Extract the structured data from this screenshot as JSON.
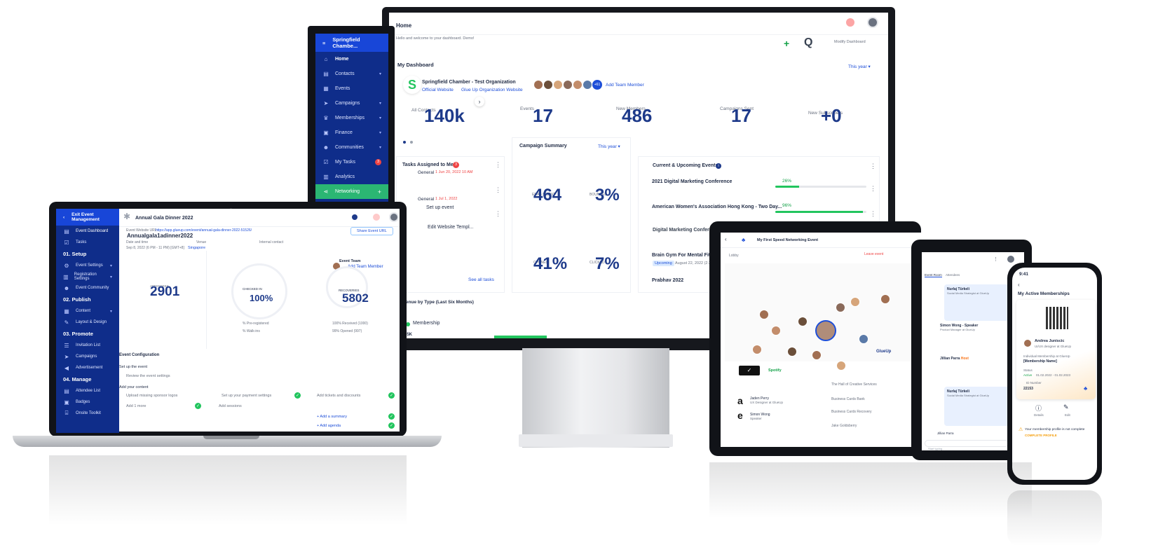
{
  "monitor": {
    "header_title": "Home",
    "header_sub": "Hello and welcome to your dashboard. Demo!",
    "modify_label": "Modify Dashboard",
    "org_short": "Springfield Chambe...",
    "nav": [
      {
        "label": "Home",
        "icon": "home-icon"
      },
      {
        "label": "Contacts",
        "icon": "contacts-icon"
      },
      {
        "label": "Events",
        "icon": "calendar-icon"
      },
      {
        "label": "Campaigns",
        "icon": "send-icon"
      },
      {
        "label": "Memberships",
        "icon": "crown-icon"
      },
      {
        "label": "Finance",
        "icon": "wallet-icon"
      },
      {
        "label": "Communities",
        "icon": "people-icon"
      },
      {
        "label": "My Tasks",
        "icon": "tasks-icon",
        "badge": "3"
      },
      {
        "label": "Analytics",
        "icon": "chart-icon"
      },
      {
        "label": "Networking",
        "icon": "share-icon"
      }
    ],
    "dashboard_title": "My Dashboard",
    "this_year": "This year",
    "org_name": "Springfield Chamber - Test Organization",
    "official_website": "Official Website",
    "glue_up_site": "Glue Up Organization Website",
    "team_more": "+61",
    "add_team_member": "Add Team Member",
    "stats": [
      {
        "value": "140k",
        "label": "All Contacts"
      },
      {
        "value": "17",
        "label": "Events"
      },
      {
        "value": "486",
        "label": "New Members"
      },
      {
        "value": "17",
        "label": "Campaigns Sent"
      },
      {
        "value": "+0",
        "label": "New Subscribers"
      }
    ],
    "tasks_title": "Tasks Assigned to Me",
    "tasks_badge": "3",
    "tasks": [
      {
        "cat": "General",
        "date": "1 Jun 20, 2022 10 AM",
        "name": "Set up event"
      },
      {
        "cat": "General",
        "date": "1 Jul 1, 2022",
        "name": "Edit Website Templ..."
      }
    ],
    "see_all_tasks": "See all tasks",
    "campaign_title": "Campaign Summary",
    "campaign_this_year": "This year",
    "campaign_stats": [
      {
        "value": "464",
        "label": "EMAILS SENT"
      },
      {
        "value": "3%",
        "label": "BOUNCED"
      },
      {
        "value": "41%",
        "label": "OPENED"
      },
      {
        "value": "7%",
        "label": "CLICKED"
      }
    ],
    "events_title": "Current & Upcoming Events",
    "events": [
      {
        "name": "2021 Digital Marketing Conference",
        "pct": "26%",
        "progress": 0.26
      },
      {
        "name": "American Women's Association Hong Kong - Two Day...",
        "pct": "96%",
        "progress": 0.96
      },
      {
        "name": "Digital Marketing Conference Melbourne",
        "pct": "",
        "progress": 0
      },
      {
        "name": "Brain Gym For Mental Fitness",
        "pct": "",
        "progress": 0
      },
      {
        "name": "Prabhav 2022",
        "pct": "",
        "progress": 0
      }
    ],
    "upcoming_tag": "Upcoming",
    "upcoming_date": "August 22, 2022 (2:30 P...",
    "by_type_title": "Revenue by Type (Last Six Months)",
    "membership_label": "Membership",
    "membership_value": "55K"
  },
  "laptop": {
    "exit_label": "Exit Event Management",
    "event_name": "Annualgala1adinner2022",
    "event_name_top": "Annual Gala Dinner 2022",
    "website_label": "Event Website URL:",
    "website_url": "https://app.glueup.com/event/annual-gala-dinner-2022-51526/",
    "share_btn": "Share Event URL",
    "date_label": "Date and time",
    "date_value": "Sep 8, 2022 (6 PM - 11 PM) [GMT+8]",
    "venue_label": "Venue",
    "venue_value": "Singapore",
    "contact_label": "Internal contact",
    "event_team": "Event Team",
    "add_team_member": "Add Team Member",
    "nav": [
      {
        "label": "Event Dashboard",
        "type": "item",
        "icon": "dashboard-icon"
      },
      {
        "label": "Tasks",
        "type": "item",
        "icon": "tasks-icon"
      },
      {
        "label": "01. Setup",
        "type": "section"
      },
      {
        "label": "Event Settings",
        "type": "item",
        "icon": "settings-icon"
      },
      {
        "label": "Registration Settings",
        "type": "item",
        "icon": "form-icon"
      },
      {
        "label": "Event Community",
        "type": "item",
        "icon": "people-icon"
      },
      {
        "label": "02. Publish",
        "type": "section"
      },
      {
        "label": "Content",
        "type": "item",
        "icon": "content-icon"
      },
      {
        "label": "Layout & Design",
        "type": "item",
        "icon": "design-icon"
      },
      {
        "label": "03. Promote",
        "type": "section"
      },
      {
        "label": "Invitation List",
        "type": "item",
        "icon": "list-icon"
      },
      {
        "label": "Campaigns",
        "type": "item",
        "icon": "send-icon"
      },
      {
        "label": "Advertisement",
        "type": "item",
        "icon": "megaphone-icon"
      },
      {
        "label": "04. Manage",
        "type": "section"
      },
      {
        "label": "Attendee List",
        "type": "item",
        "icon": "attendee-icon"
      },
      {
        "label": "Badges",
        "type": "item",
        "icon": "badge-icon"
      },
      {
        "label": "Onsite Toolkit",
        "type": "item",
        "icon": "toolkit-icon"
      }
    ],
    "stats": [
      {
        "value": "2901",
        "label": "ATTENDEES"
      },
      {
        "value": "100%",
        "label": "CHECKED IN"
      },
      {
        "value": "5802",
        "label": "RECOVERIES"
      }
    ],
    "legend": [
      "% Pre-registered",
      "% Walk-ins",
      "100% Received (1000)",
      "99% Opened (997)"
    ],
    "config_title": "Event Configuration",
    "setup_label": "Set up the event",
    "setup_item": "Review the event settings",
    "content_label": "Add your content",
    "config_items": [
      "Upload missing sponsor logos",
      "Set up your payment settings",
      "Add tickets and discounts",
      "Add 1 more",
      "Add sessions",
      "+ Add a summary",
      "+ Add agenda"
    ]
  },
  "tablet": {
    "title": "My First Speed Networking Event",
    "lobby": "Lobby",
    "leave_btn": "Leave event",
    "list_items": [
      "The Hall of Creative Services",
      "Business Cards Bank",
      "Business Cards Recovery",
      "Jake Goldsberry"
    ],
    "people": [
      {
        "name": "Jaden Perry",
        "role": "UX Designer at GlueUp"
      },
      {
        "name": "Simon Wong",
        "role": "Speaker"
      }
    ],
    "brand": "GlueUp",
    "spotify": "Spotify"
  },
  "chat": {
    "tabs": [
      "Event Room",
      "Attendees"
    ],
    "messages": [
      {
        "name": "Nurlaj Türkeli",
        "role": "Social Media Strategist at GlueUp"
      },
      {
        "name": "Simon Wong - Speaker",
        "role": "Product Manager at GlueUp"
      },
      {
        "name": "Jillian Parra",
        "role": "Host"
      },
      {
        "name": "Nurlaj Türkeli",
        "role": "Social Media Strategist at GlueUp"
      },
      {
        "name": "Jillian Parra",
        "role": ""
      }
    ],
    "input_placeholder": "Start typing..."
  },
  "phone": {
    "time": "9:41",
    "title": "My Active Memberships",
    "member_name": "Andrea Juniscic",
    "member_role": "UI/UX designer at GlueUp",
    "plan_label": "Individual Membership at GlueUp",
    "plan_name": "[Membership Name]",
    "status_label": "Status",
    "status_value": "Active",
    "status_dates": "01.02.2022 - 01.02.2023",
    "id_label": "ID Number",
    "id_value": "22153",
    "details_btn": "Details",
    "edit_btn": "Edit",
    "notice": "Your membership profile is not complete",
    "notice_cta": "COMPLETE PROFILE"
  },
  "colors": {
    "navy": "#0f2d8a",
    "blue": "#1846d8",
    "green": "#22c55e",
    "red": "#ef4444",
    "stat": "#1e3a8a"
  }
}
